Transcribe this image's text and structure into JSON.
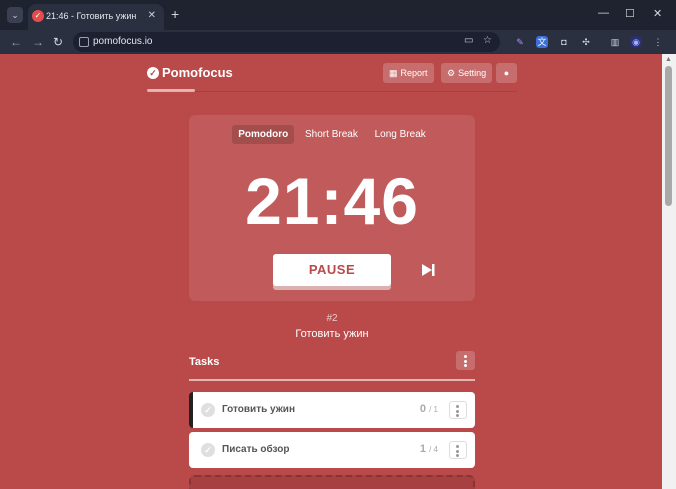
{
  "browser": {
    "tab_title": "21:46 - Готовить ужин",
    "url": "pomofocus.io"
  },
  "header": {
    "logo": "Pomofocus",
    "report_label": "Report",
    "setting_label": "Setting"
  },
  "timer": {
    "modes": [
      "Pomodoro",
      "Short Break",
      "Long Break"
    ],
    "active_mode": "Pomodoro",
    "time": "21:46",
    "pause_label": "PAUSE"
  },
  "session": {
    "number": "#2",
    "current_task": "Готовить ужин"
  },
  "tasks": {
    "title": "Tasks",
    "items": [
      {
        "name": "Готовить ужин",
        "done": "0",
        "total": "/ 1"
      },
      {
        "name": "Писать обзор",
        "done": "1",
        "total": "/ 4"
      }
    ]
  },
  "colors": {
    "accent": "#ba4949",
    "chrome": "#1f2330"
  }
}
